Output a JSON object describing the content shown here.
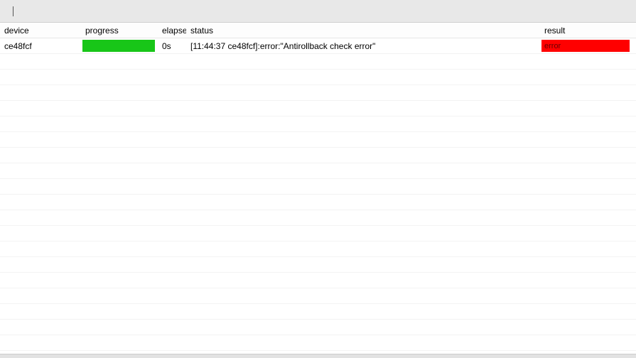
{
  "columns": {
    "device": "device",
    "progress": "progress",
    "elapse": "elapse",
    "status": "status",
    "result": "result"
  },
  "rows": [
    {
      "device": "ce48fcf",
      "progress_pct": 100,
      "progress_color": "#18c618",
      "elapse": "0s",
      "status": "[11:44:37 ce48fcf]:error:\"Antirollback check error\"",
      "result": "error",
      "result_bg": "#ff0000"
    }
  ],
  "empty_row_count": 19
}
